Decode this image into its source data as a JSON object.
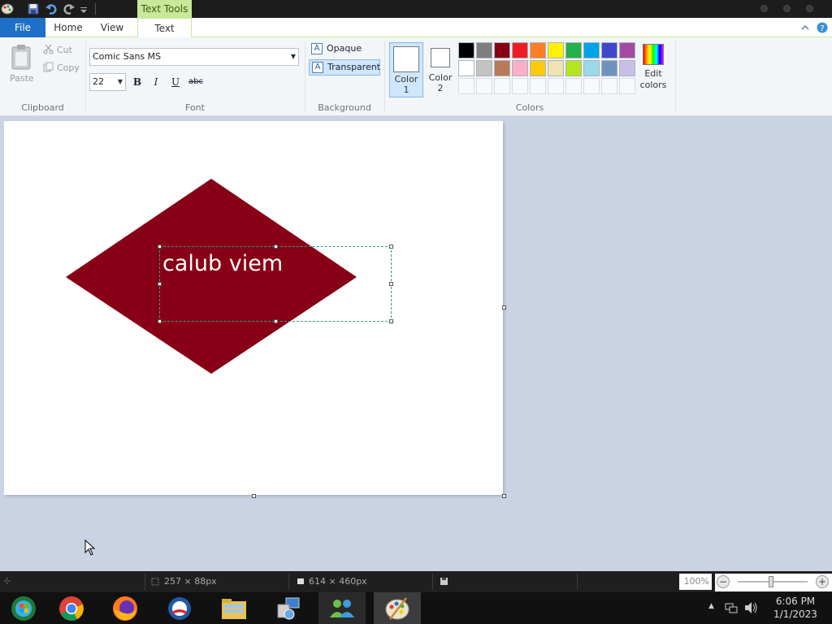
{
  "titlebar": {
    "context_tab": "Text Tools"
  },
  "tabs": {
    "file": "File",
    "home": "Home",
    "view": "View",
    "text": "Text"
  },
  "clipboard": {
    "paste": "Paste",
    "cut": "Cut",
    "copy": "Copy",
    "group": "Clipboard"
  },
  "font": {
    "family": "Comic Sans MS",
    "size": "22",
    "bold": "B",
    "italic": "I",
    "underline": "U",
    "strike": "abc",
    "group": "Font"
  },
  "background": {
    "opaque": "Opaque",
    "transparent": "Transparent",
    "selected": "Transparent",
    "group": "Background"
  },
  "colors": {
    "color1_label": "Color",
    "color1_num": "1",
    "color2_label": "Color",
    "color2_num": "2",
    "edit_label": "Edit",
    "edit_label2": "colors",
    "group": "Colors",
    "color1": "#ffffff",
    "color2": "#ffffff",
    "palette_row1": [
      "#000000",
      "#7f7f7f",
      "#880015",
      "#ed1c24",
      "#ff7f27",
      "#fff200",
      "#22b14c",
      "#00a2e8",
      "#3f48cc",
      "#a349a4"
    ],
    "palette_row2": [
      "#ffffff",
      "#c3c3c3",
      "#b97a57",
      "#ffaec9",
      "#ffc90e",
      "#efe4b0",
      "#b5e61d",
      "#99d9ea",
      "#7092be",
      "#c8bfe7"
    ]
  },
  "canvas": {
    "text": "calub viem",
    "diamond_color": "#880015",
    "text_color": "#ffffff"
  },
  "status": {
    "selection_size": "257 × 88px",
    "image_size": "614 × 460px",
    "zoom": "100%"
  },
  "taskbar": {
    "time": "6:06 PM",
    "date": "1/1/2023",
    "apps": [
      "windows-media-center-icon",
      "chrome-icon",
      "firefox-icon",
      "obama-logo-icon",
      "file-explorer-icon",
      "network-setup-icon",
      "messenger-icon",
      "paint-icon"
    ]
  }
}
